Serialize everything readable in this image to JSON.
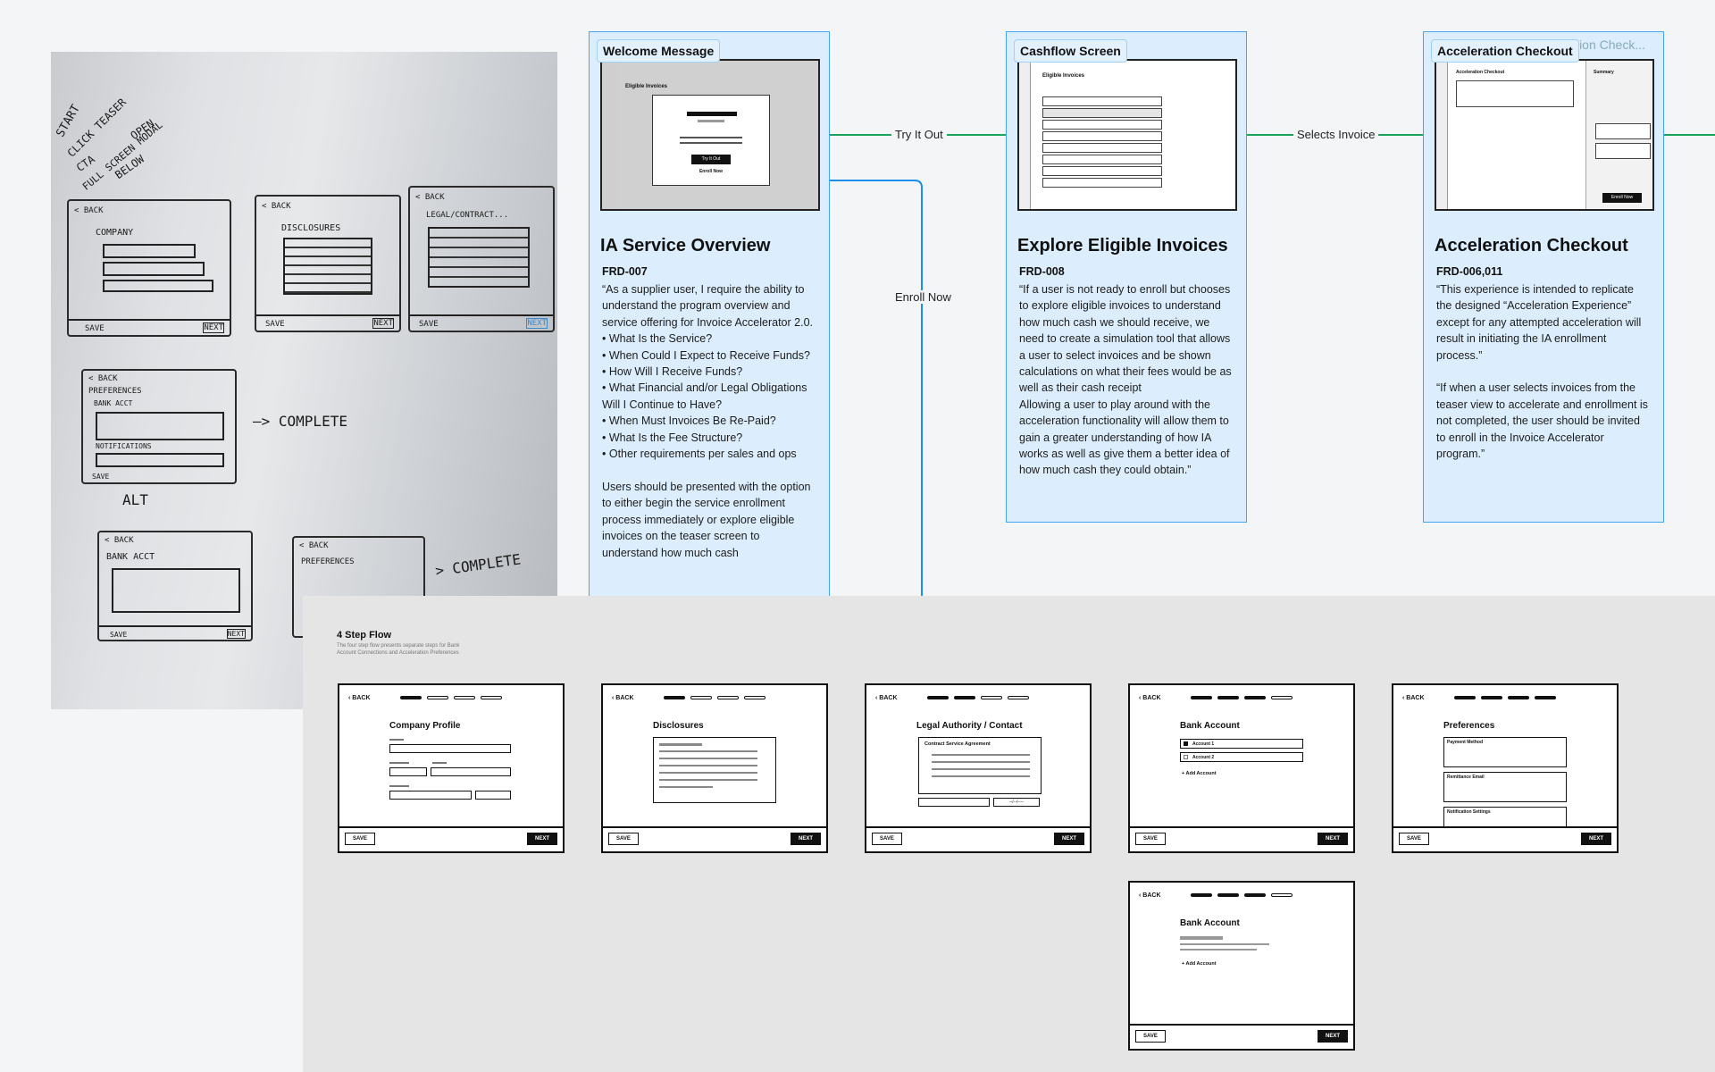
{
  "whiteboard": {
    "notes": [
      "START",
      "CLICK TEASER",
      "CTA",
      "OPEN",
      "FULL SCREEN MODAL",
      "BELOW"
    ],
    "sketches": {
      "s1": {
        "back": "< BACK",
        "field": "COMPANY",
        "save": "SAVE",
        "next": "NEXT"
      },
      "s2": {
        "back": "< BACK",
        "field": "DISCLOSURES",
        "save": "SAVE",
        "next": "NEXT"
      },
      "s3": {
        "back": "< BACK",
        "field": "LEGAL/CONTRACT...",
        "save": "SAVE",
        "next": "NEXT"
      },
      "s4": {
        "back": "< BACK",
        "field": "PREFERENCES",
        "sub1": "BANK ACCT",
        "sub2": "NOTIFICATIONS",
        "save": "SAVE"
      },
      "complete1": "—> COMPLETE",
      "alt": "ALT",
      "s5": {
        "back": "< BACK",
        "field": "BANK ACCT",
        "save": "SAVE",
        "next": "NEXT"
      },
      "s6": {
        "back": "< BACK",
        "field": "PREFERENCES"
      },
      "complete2": "> COMPLETE"
    }
  },
  "cards": [
    {
      "tab": "Welcome Message",
      "thumb_heading": "Eligible Invoices",
      "thumb_cta": "Try It Out",
      "thumb_link": "Enroll Now",
      "title": "IA Service Overview",
      "code": "FRD-007",
      "body": "“As a supplier user, I require the ability to understand the program overview and service offering for Invoice Accelerator 2.0.\n• What Is the Service?\n• When Could I Expect to Receive Funds?\n• How Will I Receive Funds?\n• What Financial and/or Legal Obligations Will I Continue to Have?\n• When Must Invoices Be Re-Paid?\n• What Is the Fee Structure?\n• Other requirements per sales and ops\n\nUsers should be presented with the option to either begin the service enrollment process immediately or explore eligible invoices on the teaser screen to understand how much cash"
    },
    {
      "tab": "Cashflow Screen",
      "thumb_heading": "Eligible Invoices",
      "title": "Explore Eligible Invoices",
      "code": "FRD-008",
      "body": "“If a user is not ready to enroll but chooses to explore eligible invoices to understand how much cash we should receive, we need to create a simulation tool that allows a user to select invoices and be shown calculations on what their fees would be as well as their cash receipt\nAllowing a user to play around with the acceleration functionality will allow them to gain a greater understanding of how IA works as well as give them a better idea of how much cash they could obtain.”"
    },
    {
      "tab": "Acceleration Checkout",
      "tab_ghost": "ion Check...",
      "thumb_heading": "Acceleration Checkout",
      "thumb_summary": "Summary",
      "thumb_cta": "Enroll Now",
      "title": "Acceleration  Checkout",
      "code": "FRD-006,011",
      "body": "“This experience is intended to replicate the designed “Acceleration Experience” except for any attempted acceleration will result in initiating the IA enrollment process.”\n\n“If when a user selects invoices from the teaser view to accelerate and enrollment is not completed, the user should be invited to enroll in the Invoice Accelerator program.”"
    }
  ],
  "edges": {
    "try_it_out": "Try It Out",
    "enroll_now": "Enroll Now",
    "selects_invoice": "Selects Invoice"
  },
  "colors": {
    "card_bg": "#dceefd",
    "card_border": "#45a6f0",
    "edge_green": "#1aa35a",
    "edge_blue": "#1c8fe8"
  },
  "panel": {
    "title": "4 Step Flow",
    "subtitle": "The four step flow presents separate steps for Bank Account Connections and Acceleration Preferences",
    "back_label": "BACK",
    "save_label": "SAVE",
    "next_label": "NEXT",
    "frames": [
      {
        "title": "Company Profile",
        "steps_done": 1
      },
      {
        "title": "Disclosures",
        "steps_done": 1
      },
      {
        "title": "Legal Authority / Contact",
        "steps_done": 2,
        "agreement": "Contract Service Agreement",
        "date_ph": "--/--/----"
      },
      {
        "title": "Bank Account",
        "steps_done": 3,
        "account1": "Account 1",
        "account2": "Account 2",
        "add": "+ Add Account"
      },
      {
        "title": "Preferences",
        "steps_done": 4,
        "box1": "Payment Method",
        "box2": "Remittance Email",
        "box3": "Notification Settings"
      },
      {
        "title": "Bank Account",
        "steps_done": 3,
        "add": "+ Add Account"
      }
    ]
  }
}
